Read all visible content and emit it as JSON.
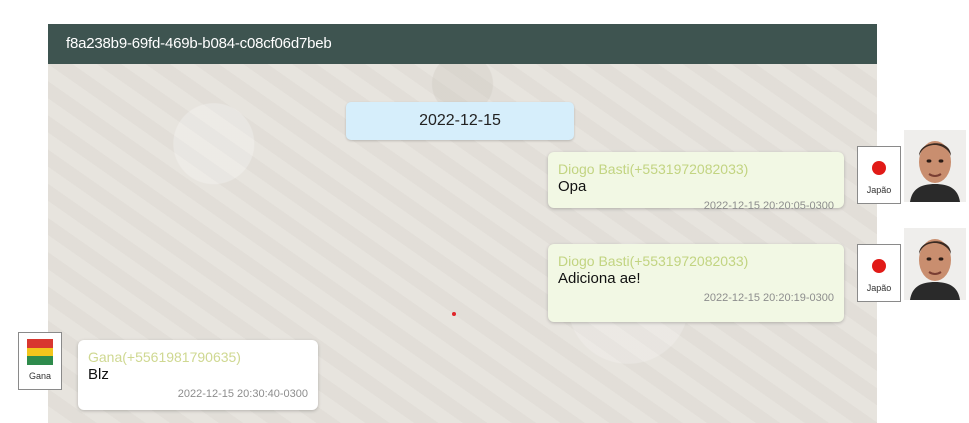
{
  "chat": {
    "title": "f8a238b9-69fd-469b-b084-c08cf06d7beb",
    "date_separator": "2022-12-15"
  },
  "messages": [
    {
      "direction": "outgoing",
      "sender": "Diogo Basti(+5531972082033)",
      "text": "Opa",
      "timestamp": "2022-12-15 20:20:05-0300",
      "flag_label": "Japão",
      "avatar_icon": "person-photo-icon"
    },
    {
      "direction": "outgoing",
      "sender": "Diogo Basti(+5531972082033)",
      "text": "Adiciona ae!",
      "timestamp": "2022-12-15 20:20:19-0300",
      "flag_label": "Japão",
      "avatar_icon": "person-photo-icon"
    },
    {
      "direction": "incoming",
      "sender": "Gana(+5561981790635)",
      "text": "Blz",
      "timestamp": "2022-12-15 20:30:40-0300",
      "flag_label": "Gana",
      "avatar_icon": "ghana-flag-icon"
    }
  ],
  "colors": {
    "header_bg": "#3e5450",
    "outgoing_bubble": "#f2f8e4",
    "incoming_bubble": "#ffffff",
    "date_chip": "#d6eefb",
    "sender_name": "#c2d481"
  }
}
